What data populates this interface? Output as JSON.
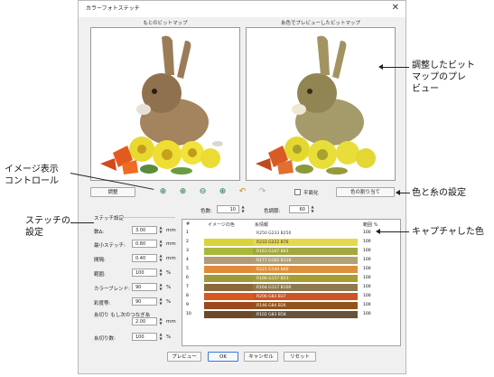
{
  "dialog": {
    "title": "カラーフォトステッチ",
    "close_glyph": "✕",
    "original_bitmap_label": "もとのビットマップ",
    "preview_bitmap_label": "糸色でプレビューしたビットマップ",
    "adjust_button": "調整",
    "preview_checkbox_label": "平面化",
    "color_assign_button": "色の割り当て",
    "colors_label": "色数:",
    "colors_value": "10",
    "color_tolerance_label": "色調節:",
    "color_tolerance_value": "60",
    "stitch_settings": {
      "group_label": "ステッチ設定",
      "fields": [
        {
          "label": "数Δ:",
          "value": "3.00",
          "unit": "mm"
        },
        {
          "label": "最小ステッチ:",
          "value": "0.80",
          "unit": "mm"
        },
        {
          "label": "間隔:",
          "value": "0.40",
          "unit": "mm"
        },
        {
          "label": "範囲:",
          "value": "100",
          "unit": "%"
        },
        {
          "label": "カラーブレンド:",
          "value": "90",
          "unit": "%"
        },
        {
          "label": "彩度等:",
          "value": "90",
          "unit": "%"
        }
      ],
      "min_stitch_label": "糸切り もし次のつなぎ糸",
      "min_stitch_value": "2.00",
      "min_stitch_unit": "mm",
      "density_label": "糸切り数:",
      "density_value": "100",
      "density_unit": "%"
    },
    "table": {
      "headers": [
        "#",
        "イメージの色",
        "糸情報",
        "範囲 %"
      ],
      "rows": [
        {
          "num": "1",
          "color": "#ffffff",
          "yarn": "R250 G233 B250",
          "pct": "100"
        },
        {
          "num": "2",
          "color": "#d9d43a",
          "yarn": "R233 G222 B76",
          "pct": "100"
        },
        {
          "num": "3",
          "color": "#a9b83a",
          "yarn": "R163 G167 B63",
          "pct": "100"
        },
        {
          "num": "4",
          "color": "#b59a7a",
          "yarn": "R177 G162 B118",
          "pct": "100"
        },
        {
          "num": "5",
          "color": "#e08a3a",
          "yarn": "R221 G144 B60",
          "pct": "100"
        },
        {
          "num": "6",
          "color": "#9c9a3a",
          "yarn": "R166 G157 B53",
          "pct": "100"
        },
        {
          "num": "7",
          "color": "#8a6a3a",
          "yarn": "R164 G117 B100",
          "pct": "100"
        },
        {
          "num": "8",
          "color": "#d65a1e",
          "yarn": "R206 G83 B37",
          "pct": "100"
        },
        {
          "num": "9",
          "color": "#9a4a1e",
          "yarn": "R146 G84 B26",
          "pct": "100"
        },
        {
          "num": "10",
          "color": "#6a4a2a",
          "yarn": "R102 G83 B58",
          "pct": "100"
        }
      ]
    },
    "footer_buttons": [
      "プレビュー",
      "OK",
      "キャンセル",
      "リセット"
    ]
  },
  "callouts": {
    "preview": "調整したビット\nマップのプレ\nビュー",
    "image_controls": "イメージ表示\nコントロール",
    "color_settings": "色と糸の設定",
    "stitch_settings": "ステッチの\n設定",
    "captured_colors": "キャプチャした色"
  },
  "toolbar_icons": [
    "zoom-fit-icon",
    "zoom-in-icon",
    "zoom-out-icon",
    "zoom-actual-icon",
    "zoom-box-icon",
    "undo-icon",
    "redo-icon"
  ]
}
